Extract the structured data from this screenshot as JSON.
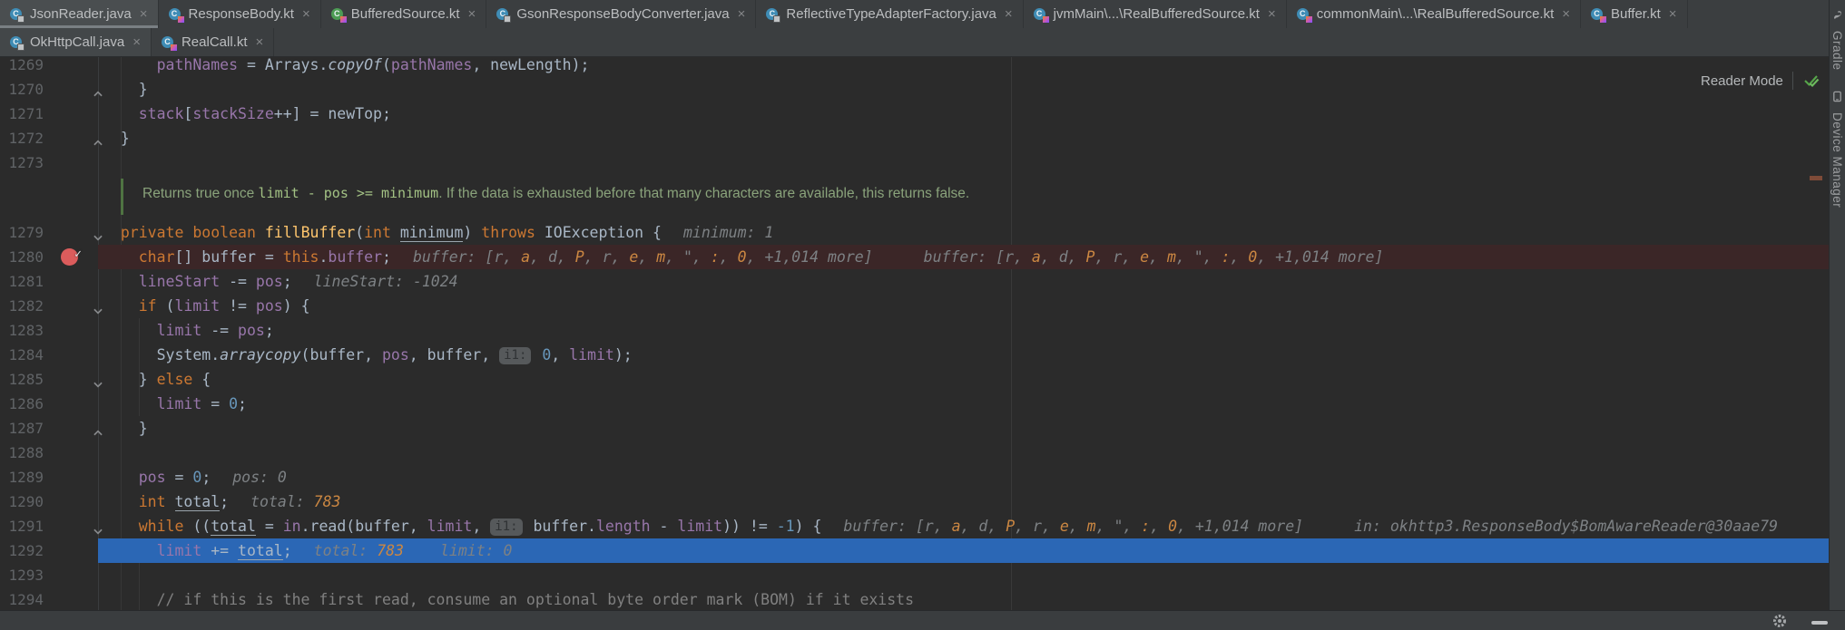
{
  "tabs": {
    "close_glyph": "×",
    "row1": [
      {
        "label": "JsonReader.java",
        "kind": "java",
        "locked": true,
        "active": true
      },
      {
        "label": "ResponseBody.kt",
        "kind": "kotlin",
        "locked": true
      },
      {
        "label": "BufferedSource.kt",
        "kind": "kotlin-green",
        "locked": true
      },
      {
        "label": "GsonResponseBodyConverter.java",
        "kind": "java",
        "locked": true
      },
      {
        "label": "ReflectiveTypeAdapterFactory.java",
        "kind": "java",
        "locked": true
      },
      {
        "label": "jvmMain\\...\\RealBufferedSource.kt",
        "kind": "kotlin",
        "locked": true
      },
      {
        "label": "commonMain\\...\\RealBufferedSource.kt",
        "kind": "kotlin",
        "locked": true
      },
      {
        "label": "Buffer.kt",
        "kind": "kotlin",
        "locked": true
      }
    ],
    "row2": [
      {
        "label": "OkHttpCall.java",
        "kind": "java",
        "locked": true,
        "current": true
      },
      {
        "label": "RealCall.kt",
        "kind": "kotlin",
        "locked": true
      }
    ]
  },
  "toolbar": {
    "reader_mode_label": "Reader Mode"
  },
  "right_stripe": {
    "items": [
      {
        "label": "Gradle",
        "icon": "gradle-icon"
      },
      {
        "label": "Device Manager",
        "icon": "device-manager-icon"
      }
    ]
  },
  "bottom_bar": {
    "icons": [
      "settings-gear-icon",
      "hide-icon"
    ]
  },
  "editor": {
    "doc_comment": {
      "prose_before": "Returns true once ",
      "code": "limit - pos >= minimum",
      "prose_after": ". If the data is exhausted before that many characters are available, this returns false."
    },
    "lines": [
      {
        "num": 1269,
        "segs": [
          [
            "p",
            "      "
          ],
          [
            "f",
            "pathNames"
          ],
          [
            "p",
            " = Arrays."
          ],
          [
            "i",
            "copyOf"
          ],
          [
            "p",
            "("
          ],
          [
            "f",
            "pathNames"
          ],
          [
            "p",
            ", newLength);"
          ]
        ]
      },
      {
        "num": 1270,
        "fold": "up",
        "segs": [
          [
            "p",
            "    }"
          ]
        ]
      },
      {
        "num": 1271,
        "segs": [
          [
            "p",
            "    "
          ],
          [
            "f",
            "stack"
          ],
          [
            "p",
            "["
          ],
          [
            "f",
            "stackSize"
          ],
          [
            "p",
            "++] = newTop;"
          ]
        ]
      },
      {
        "num": 1272,
        "fold": "up",
        "segs": [
          [
            "p",
            "  }"
          ]
        ]
      },
      {
        "num": 1273,
        "segs": []
      },
      {
        "num": 1279,
        "fold": "down",
        "segs": [
          [
            "p",
            "  "
          ],
          [
            "k",
            "private"
          ],
          [
            "p",
            " "
          ],
          [
            "k",
            "boolean"
          ],
          [
            "p",
            " "
          ],
          [
            "m",
            "fillBuffer"
          ],
          [
            "p",
            "("
          ],
          [
            "k",
            "int"
          ],
          [
            "p",
            " "
          ],
          [
            "u",
            "minimum"
          ],
          [
            "p",
            ") "
          ],
          [
            "k",
            "throws"
          ],
          [
            "p",
            " IOException {"
          ]
        ],
        "hints": [
          {
            "gap": 24,
            "segs": [
              [
                "d",
                "minimum: 1"
              ]
            ]
          }
        ]
      },
      {
        "num": 1280,
        "bg": "bp",
        "breakpoint": true,
        "segs": [
          [
            "p",
            "    "
          ],
          [
            "k",
            "char"
          ],
          [
            "p",
            "[] buffer = "
          ],
          [
            "k",
            "this"
          ],
          [
            "p",
            "."
          ],
          [
            "f",
            "buffer"
          ],
          [
            "p",
            ";"
          ]
        ],
        "hints": [
          {
            "gap": 24,
            "segs": [
              [
                "d",
                "buffer: ["
              ],
              [
                "d",
                "r"
              ],
              [
                "d",
                ", "
              ],
              [
                "o",
                "a"
              ],
              [
                "d",
                ", "
              ],
              [
                "d",
                "d"
              ],
              [
                "d",
                ", "
              ],
              [
                "o",
                "P"
              ],
              [
                "d",
                ", "
              ],
              [
                "d",
                "r"
              ],
              [
                "d",
                ", "
              ],
              [
                "o",
                "e"
              ],
              [
                "d",
                ", "
              ],
              [
                "o",
                "m"
              ],
              [
                "d",
                ", \", "
              ],
              [
                "o",
                ":"
              ],
              [
                "d",
                ", "
              ],
              [
                "o",
                "0"
              ],
              [
                "d",
                ", +1,014 more]"
              ]
            ]
          },
          {
            "gap": 56,
            "segs": [
              [
                "d",
                "buffer: ["
              ],
              [
                "d",
                "r"
              ],
              [
                "d",
                ", "
              ],
              [
                "o",
                "a"
              ],
              [
                "d",
                ", "
              ],
              [
                "d",
                "d"
              ],
              [
                "d",
                ", "
              ],
              [
                "o",
                "P"
              ],
              [
                "d",
                ", "
              ],
              [
                "d",
                "r"
              ],
              [
                "d",
                ", "
              ],
              [
                "o",
                "e"
              ],
              [
                "d",
                ", "
              ],
              [
                "o",
                "m"
              ],
              [
                "d",
                ", \", "
              ],
              [
                "o",
                ":"
              ],
              [
                "d",
                ", "
              ],
              [
                "o",
                "0"
              ],
              [
                "d",
                ", +1,014 more]"
              ]
            ]
          }
        ]
      },
      {
        "num": 1281,
        "segs": [
          [
            "p",
            "    "
          ],
          [
            "f",
            "lineStart"
          ],
          [
            "p",
            " -= "
          ],
          [
            "f",
            "pos"
          ],
          [
            "p",
            ";"
          ]
        ],
        "hints": [
          {
            "gap": 24,
            "segs": [
              [
                "d",
                "lineStart: -1024"
              ]
            ]
          }
        ]
      },
      {
        "num": 1282,
        "fold": "down",
        "segs": [
          [
            "p",
            "    "
          ],
          [
            "k",
            "if"
          ],
          [
            "p",
            " ("
          ],
          [
            "f",
            "limit"
          ],
          [
            "p",
            " != "
          ],
          [
            "f",
            "pos"
          ],
          [
            "p",
            ") {"
          ]
        ]
      },
      {
        "num": 1283,
        "segs": [
          [
            "p",
            "      "
          ],
          [
            "f",
            "limit"
          ],
          [
            "p",
            " -= "
          ],
          [
            "f",
            "pos"
          ],
          [
            "p",
            ";"
          ]
        ]
      },
      {
        "num": 1284,
        "segs": [
          [
            "p",
            "      System."
          ],
          [
            "i",
            "arraycopy"
          ],
          [
            "p",
            "(buffer, "
          ],
          [
            "f",
            "pos"
          ],
          [
            "p",
            ", buffer, "
          ],
          [
            "pill",
            "i1:"
          ],
          [
            "p",
            " "
          ],
          [
            "n",
            "0"
          ],
          [
            "p",
            ", "
          ],
          [
            "f",
            "limit"
          ],
          [
            "p",
            ");"
          ]
        ]
      },
      {
        "num": 1285,
        "fold": "down",
        "segs": [
          [
            "p",
            "    } "
          ],
          [
            "k",
            "else"
          ],
          [
            "p",
            " {"
          ]
        ]
      },
      {
        "num": 1286,
        "segs": [
          [
            "p",
            "      "
          ],
          [
            "f",
            "limit"
          ],
          [
            "p",
            " = "
          ],
          [
            "n",
            "0"
          ],
          [
            "p",
            ";"
          ]
        ]
      },
      {
        "num": 1287,
        "fold": "up",
        "segs": [
          [
            "p",
            "    }"
          ]
        ]
      },
      {
        "num": 1288,
        "segs": []
      },
      {
        "num": 1289,
        "segs": [
          [
            "p",
            "    "
          ],
          [
            "f",
            "pos"
          ],
          [
            "p",
            " = "
          ],
          [
            "n",
            "0"
          ],
          [
            "p",
            ";"
          ]
        ],
        "hints": [
          {
            "gap": 24,
            "segs": [
              [
                "d",
                "pos: 0"
              ]
            ]
          }
        ]
      },
      {
        "num": 1290,
        "segs": [
          [
            "p",
            "    "
          ],
          [
            "k",
            "int"
          ],
          [
            "p",
            " "
          ],
          [
            "u",
            "total"
          ],
          [
            "p",
            ";"
          ]
        ],
        "hints": [
          {
            "gap": 24,
            "segs": [
              [
                "d",
                "total: "
              ],
              [
                "o",
                "783"
              ]
            ]
          }
        ]
      },
      {
        "num": 1291,
        "fold": "down",
        "segs": [
          [
            "p",
            "    "
          ],
          [
            "k",
            "while"
          ],
          [
            "p",
            " (("
          ],
          [
            "u",
            "total"
          ],
          [
            "p",
            " = "
          ],
          [
            "f",
            "in"
          ],
          [
            "p",
            ".read(buffer, "
          ],
          [
            "f",
            "limit"
          ],
          [
            "p",
            ", "
          ],
          [
            "pill",
            "i1:"
          ],
          [
            "p",
            " buffer."
          ],
          [
            "f",
            "length"
          ],
          [
            "p",
            " - "
          ],
          [
            "f",
            "limit"
          ],
          [
            "p",
            ")) != "
          ],
          [
            "n",
            "-1"
          ],
          [
            "p",
            ") {"
          ]
        ],
        "hints": [
          {
            "gap": 24,
            "segs": [
              [
                "d",
                "buffer: ["
              ],
              [
                "d",
                "r"
              ],
              [
                "d",
                ", "
              ],
              [
                "o",
                "a"
              ],
              [
                "d",
                ", "
              ],
              [
                "d",
                "d"
              ],
              [
                "d",
                ", "
              ],
              [
                "o",
                "P"
              ],
              [
                "d",
                ", "
              ],
              [
                "d",
                "r"
              ],
              [
                "d",
                ", "
              ],
              [
                "o",
                "e"
              ],
              [
                "d",
                ", "
              ],
              [
                "o",
                "m"
              ],
              [
                "d",
                ", \", "
              ],
              [
                "o",
                ":"
              ],
              [
                "d",
                ", "
              ],
              [
                "o",
                "0"
              ],
              [
                "d",
                ", +1,014 more]"
              ]
            ]
          },
          {
            "gap": 56,
            "segs": [
              [
                "d",
                "in: okhttp3.ResponseBody$BomAwareReader@30aae79"
              ]
            ]
          }
        ]
      },
      {
        "num": 1292,
        "bg": "exec",
        "segs": [
          [
            "p",
            "      "
          ],
          [
            "f",
            "limit"
          ],
          [
            "p",
            " += "
          ],
          [
            "u",
            "total"
          ],
          [
            "p",
            ";"
          ]
        ],
        "hints": [
          {
            "gap": 24,
            "segs": [
              [
                "d",
                "total: "
              ],
              [
                "o",
                "783"
              ]
            ]
          },
          {
            "gap": 40,
            "segs": [
              [
                "d",
                "limit: 0"
              ]
            ]
          }
        ]
      },
      {
        "num": 1293,
        "segs": []
      },
      {
        "num": 1294,
        "segs": [
          [
            "c",
            "      // if this is the first read, consume an optional byte order mark (BOM) if it exists"
          ]
        ]
      }
    ]
  },
  "colors": {
    "bg-editor": "#2b2b2b",
    "bg-bar": "#3b3e40",
    "bg-exec": "#2b67b5",
    "bg-bpline": "#3b2627",
    "clr-kw": "#cc7832",
    "clr-field": "#9876aa",
    "clr-num": "#6897bb",
    "clr-method": "#ffc66d",
    "clr-plain": "#a9b7c6",
    "clr-comment": "#808080",
    "clr-doc": "#8aa37b",
    "clr-dbg": "#7d8184",
    "clr-dbg-hl": "#cb8742",
    "clr-bp": "#db5c5c",
    "clr-check-green": "#57a64a"
  }
}
